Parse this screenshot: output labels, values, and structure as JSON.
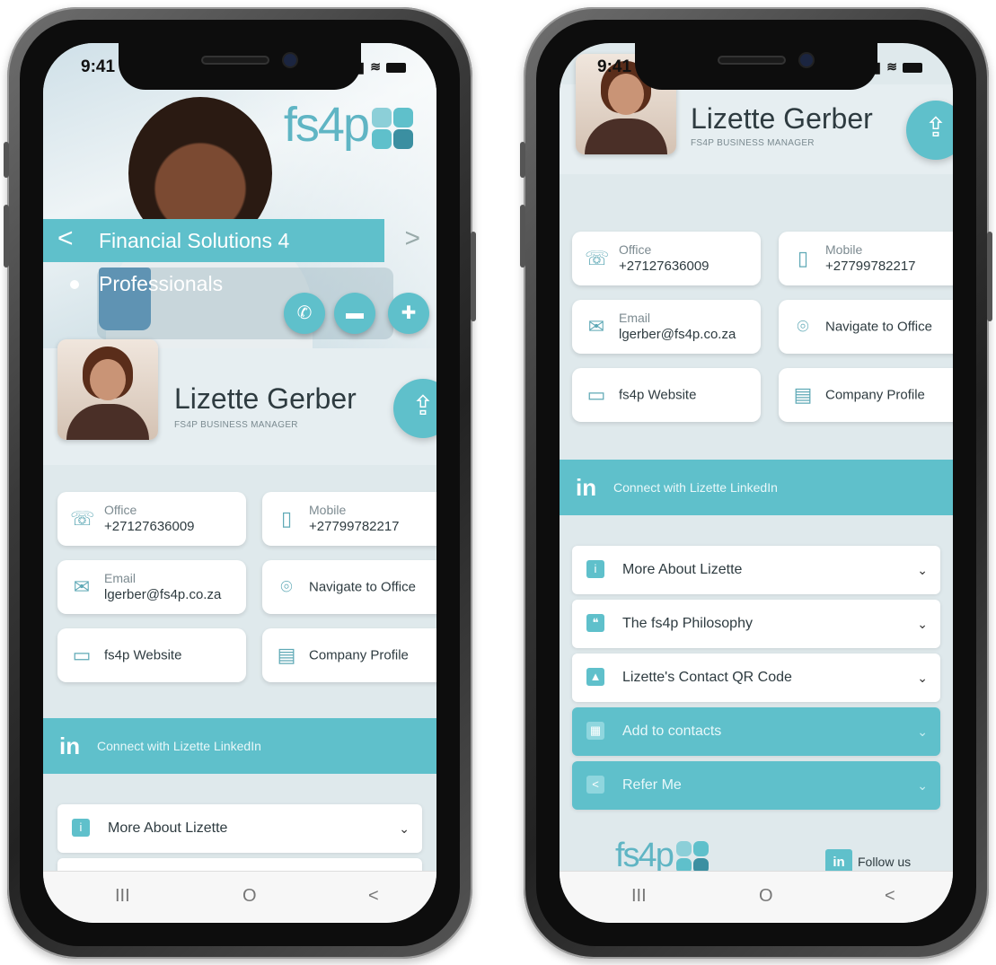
{
  "status": {
    "time": "9:41"
  },
  "hero": {
    "banner": "Financial Solutions 4 Professionals",
    "logo": "fs4p",
    "actions": [
      "whatsapp-icon",
      "message-icon",
      "add-contact-icon"
    ]
  },
  "profile": {
    "name": "Lizette Gerber",
    "role": "FS4P BUSINESS MANAGER"
  },
  "contacts": {
    "office_label": "Office",
    "office_value": "+27127636009",
    "mobile_label": "Mobile",
    "mobile_value": "+27799782217",
    "email_label": "Email",
    "email_value": "lgerber@fs4p.co.za",
    "navigate": "Navigate to Office",
    "website": "fs4p Website",
    "company": "Company Profile"
  },
  "linkedin": {
    "icon": "in",
    "label": "Connect with Lizette LinkedIn"
  },
  "accordion": [
    {
      "label": "More About Lizette",
      "icon": "info-icon"
    },
    {
      "label": "The fs4p Philosophy",
      "icon": "chat-icon"
    },
    {
      "label": "Lizette's Contact QR Code",
      "icon": "image-icon"
    },
    {
      "label": "Add to contacts",
      "icon": "contacts-icon"
    },
    {
      "label": "Refer Me",
      "icon": "share-icon"
    }
  ],
  "footer": {
    "logo": "fs4p",
    "follow": "Follow us",
    "follow_icon": "in"
  },
  "navbar": {
    "recent": "III",
    "home": "O",
    "back": "<"
  },
  "colors": {
    "accent": "#5fc0cb",
    "text": "#2e3b40"
  }
}
